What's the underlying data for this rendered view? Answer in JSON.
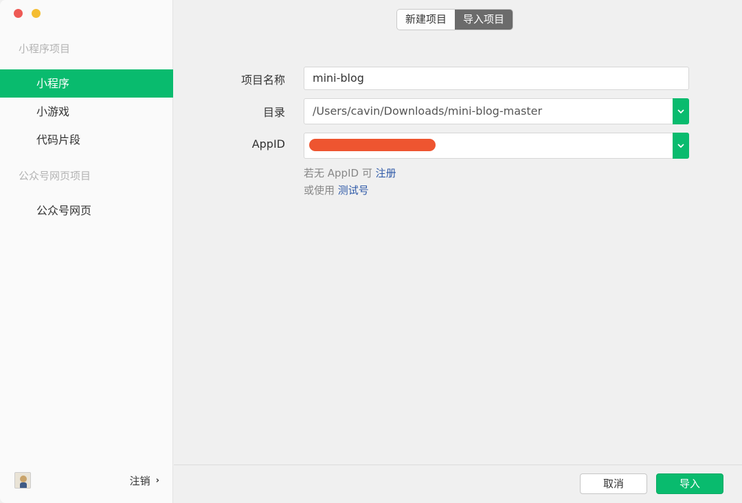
{
  "sidebar": {
    "section_mini": "小程序项目",
    "items": [
      {
        "label": "小程序"
      },
      {
        "label": "小游戏"
      },
      {
        "label": "代码片段"
      }
    ],
    "section_web": "公众号网页项目",
    "web_item": "公众号网页",
    "logout_label": "注销"
  },
  "tabs": [
    {
      "label": "新建项目"
    },
    {
      "label": "导入项目"
    }
  ],
  "form": {
    "name_label": "项目名称",
    "name_value": "mini-blog",
    "dir_label": "目录",
    "dir_value": "/Users/cavin/Downloads/mini-blog-master",
    "appid_label": "AppID",
    "hint1_prefix": "若无 AppID 可",
    "hint1_link": "注册",
    "hint2_prefix": "或使用",
    "hint2_link": "测试号"
  },
  "footer": {
    "cancel_label": "取消",
    "import_label": "导入"
  },
  "colors": {
    "accent": "#09bb6e",
    "redaction": "#ee5530"
  }
}
